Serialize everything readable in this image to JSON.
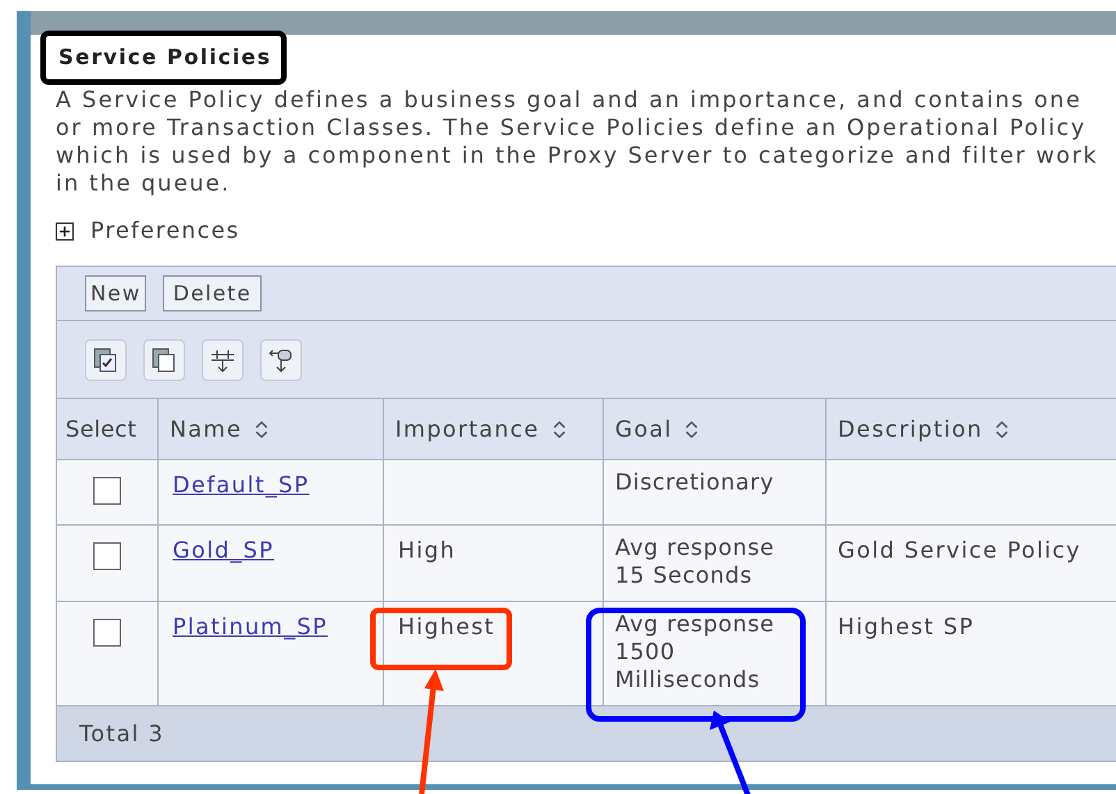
{
  "panel": {
    "title": "Service Policies",
    "description": "A Service Policy defines a business goal and an importance, and contains one or more Transaction Classes. The Service Policies define an Operational Policy which is used by a component in the Proxy Server to categorize and filter work in the queue.",
    "preferences": {
      "label": "Preferences",
      "expanded": false
    }
  },
  "buttons": [
    "New",
    "Delete"
  ],
  "toolbar_icons": [
    {
      "kind": "select-all"
    },
    {
      "kind": "deselect-all"
    },
    {
      "kind": "expand"
    },
    {
      "kind": "filter"
    }
  ],
  "table": {
    "columns": [
      {
        "label": "Select",
        "sortable": false
      },
      {
        "label": "Name",
        "sortable": true
      },
      {
        "label": "Importance",
        "sortable": true
      },
      {
        "label": "Goal",
        "sortable": true
      },
      {
        "label": "Description",
        "sortable": true
      }
    ],
    "rows": [
      {
        "checked": false,
        "name": "Default_SP",
        "importance": "",
        "goal": [
          "Discretionary"
        ],
        "description": ""
      },
      {
        "checked": false,
        "name": "Gold_SP",
        "importance": "High",
        "goal": [
          "Avg response",
          "15 Seconds"
        ],
        "description": "Gold Service Policy"
      },
      {
        "checked": false,
        "name": "Platinum_SP",
        "importance": "Highest",
        "goal": [
          "Avg response",
          "1500",
          "Milliseconds"
        ],
        "description": "Highest SP"
      }
    ],
    "footer": "Total 3"
  },
  "annotations": [
    {
      "kind": "frame",
      "color": "#000000"
    },
    {
      "kind": "frame",
      "color": "#ff3300"
    },
    {
      "kind": "frame",
      "color": "#0000ff"
    },
    {
      "kind": "arrow",
      "color": "#ff3300"
    },
    {
      "kind": "arrow",
      "color": "#0000ff"
    }
  ]
}
